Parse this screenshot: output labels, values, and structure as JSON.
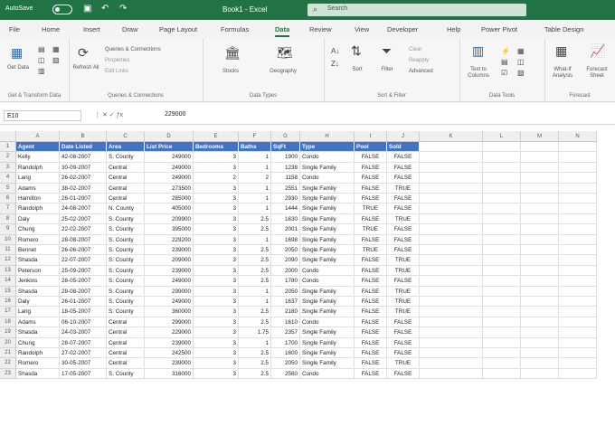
{
  "titlebar": {
    "autosave": "AutoSave",
    "doc": "Book1 - Excel",
    "search_placeholder": "Search"
  },
  "tabs": [
    "File",
    "Home",
    "Insert",
    "Draw",
    "Page Layout",
    "Formulas",
    "Data",
    "Review",
    "View",
    "Developer",
    "Help",
    "Power Pivot",
    "Table Design"
  ],
  "active_tab": "Data",
  "ribbon": {
    "groups": [
      {
        "label": "Get & Transform Data",
        "items": [
          "Get Data",
          "",
          "",
          ""
        ]
      },
      {
        "label": "Queries & Connections",
        "items": [
          "Refresh All",
          "Queries & Connections",
          "Properties",
          "Edit Links"
        ]
      },
      {
        "label": "Data Types",
        "items": [
          "Stocks",
          "Geography"
        ]
      },
      {
        "label": "Sort & Filter",
        "items": [
          "Sort",
          "Filter",
          "Clear",
          "Reapply",
          "Advanced"
        ]
      },
      {
        "label": "Data Tools",
        "items": [
          "Text to Columns"
        ]
      },
      {
        "label": "Forecast",
        "items": [
          "What-If Analysis",
          "Forecast Sheet"
        ]
      }
    ]
  },
  "formula": {
    "namebox": "E10",
    "value": "229000"
  },
  "columns": [
    "A",
    "B",
    "C",
    "D",
    "E",
    "F",
    "G",
    "H",
    "I",
    "J",
    "K",
    "L",
    "M",
    "N"
  ],
  "table": {
    "headers": [
      "Agent",
      "Date Listed",
      "Area",
      "List Price",
      "Bedrooms",
      "Baths",
      "SqFt",
      "Type",
      "Pool",
      "Sold"
    ],
    "rows": [
      [
        "Kelly",
        "42-08-2007",
        "S. County",
        "249000",
        "3",
        "1",
        "1900",
        "Condo",
        "FALSE",
        "FALSE"
      ],
      [
        "Randolph",
        "30-09-2007",
        "Central",
        "249000",
        "3",
        "1",
        "1238",
        "Single Family",
        "FALSE",
        "FALSE"
      ],
      [
        "Lang",
        "26-02-2007",
        "Central",
        "249000",
        "2",
        "2",
        "1158",
        "Condo",
        "FALSE",
        "FALSE"
      ],
      [
        "Adams",
        "38-02-2007",
        "Central",
        "273500",
        "3",
        "1",
        "2551",
        "Single Family",
        "FALSE",
        "TRUE"
      ],
      [
        "Hamilton",
        "26-01-2007",
        "Central",
        "285000",
        "3",
        "1",
        "2930",
        "Single Family",
        "FALSE",
        "FALSE"
      ],
      [
        "Randolph",
        "24-08-2007",
        "N. County",
        "405000",
        "3",
        "1",
        "1444",
        "Single Family",
        "TRUE",
        "FALSE"
      ],
      [
        "Daly",
        "25-02-2007",
        "S. County",
        "209900",
        "3",
        "2.5",
        "1630",
        "Single Family",
        "FALSE",
        "TRUE"
      ],
      [
        "Chung",
        "22-02-2007",
        "S. County",
        "395000",
        "3",
        "2.5",
        "2001",
        "Single Family",
        "TRUE",
        "FALSE"
      ],
      [
        "Romero",
        "28-08-2007",
        "S. County",
        "229200",
        "3",
        "1",
        "1698",
        "Single Family",
        "FALSE",
        "FALSE"
      ],
      [
        "Bennet",
        "26-06-2007",
        "S. County",
        "239000",
        "3",
        "2.5",
        "2050",
        "Single Family",
        "TRUE",
        "FALSE"
      ],
      [
        "Shasda",
        "22-07-2007",
        "S. County",
        "209000",
        "3",
        "2.5",
        "2090",
        "Single Family",
        "FALSE",
        "TRUE"
      ],
      [
        "Peterson",
        "25-09-2007",
        "S. County",
        "239000",
        "3",
        "2.5",
        "2000",
        "Condo",
        "FALSE",
        "TRUE"
      ],
      [
        "Jenkins",
        "28-05-2007",
        "S. County",
        "249000",
        "3",
        "2.5",
        "1780",
        "Condo",
        "FALSE",
        "FALSE"
      ],
      [
        "Shasda",
        "28-08-2007",
        "S. County",
        "299000",
        "3",
        "1",
        "2050",
        "Single Family",
        "FALSE",
        "TRUE"
      ],
      [
        "Daly",
        "26-01-2007",
        "S. County",
        "249000",
        "3",
        "1",
        "1637",
        "Single Family",
        "FALSE",
        "TRUE"
      ],
      [
        "Lang",
        "18-05-2007",
        "S. County",
        "360000",
        "3",
        "2.5",
        "2180",
        "Single Family",
        "FALSE",
        "TRUE"
      ],
      [
        "Adams",
        "06-10-2007",
        "Central",
        "299000",
        "3",
        "2.5",
        "1610",
        "Condo",
        "FALSE",
        "FALSE"
      ],
      [
        "Shasda",
        "24-03-2007",
        "Central",
        "229000",
        "3",
        "1.75",
        "2357",
        "Single Family",
        "FALSE",
        "FALSE"
      ],
      [
        "Chung",
        "28-07-2007",
        "Central",
        "239000",
        "3",
        "1",
        "1700",
        "Single Family",
        "FALSE",
        "FALSE"
      ],
      [
        "Randolph",
        "27-02-2007",
        "Central",
        "242500",
        "3",
        "2.5",
        "1600",
        "Single Family",
        "FALSE",
        "FALSE"
      ],
      [
        "Romero",
        "30-05-2007",
        "Central",
        "239000",
        "3",
        "2.5",
        "2050",
        "Single Family",
        "FALSE",
        "TRUE"
      ],
      [
        "Shasda",
        "17-05-2007",
        "S. County",
        "316000",
        "3",
        "2.5",
        "2560",
        "Condo",
        "FALSE",
        "FALSE"
      ]
    ]
  }
}
